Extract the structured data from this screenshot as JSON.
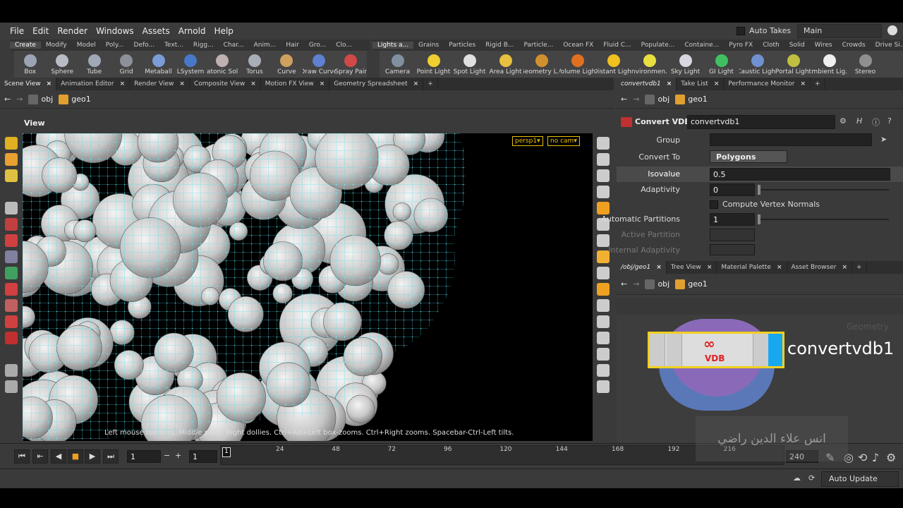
{
  "menubar": {
    "items": [
      "File",
      "Edit",
      "Render",
      "Windows",
      "Assets",
      "Arnold",
      "Help"
    ],
    "auto_takes": "Auto Takes",
    "main_select": "Main"
  },
  "shelf_left": {
    "tabs": [
      "Create",
      "Modify",
      "Model",
      "Poly...",
      "Defo...",
      "Text...",
      "Rigg...",
      "Char...",
      "Anim...",
      "Hair",
      "Gro...",
      "Clo..."
    ],
    "tools": [
      {
        "label": "Box",
        "color": "#9aa4b4"
      },
      {
        "label": "Sphere",
        "color": "#b8bcc4"
      },
      {
        "label": "Tube",
        "color": "#a0a8b8"
      },
      {
        "label": "Grid",
        "color": "#8c9098"
      },
      {
        "label": "Metaball",
        "color": "#7b9cd6"
      },
      {
        "label": "LSystem",
        "color": "#4a78c8"
      },
      {
        "label": "Platonic Sol...",
        "color": "#c0b0b0"
      },
      {
        "label": "Torus",
        "color": "#a8aeb8"
      },
      {
        "label": "Curve",
        "color": "#d0a060"
      },
      {
        "label": "Draw Curve",
        "color": "#6080d0"
      },
      {
        "label": "Spray Pair",
        "color": "#d04848"
      }
    ]
  },
  "shelf_right": {
    "tabs": [
      "Lights a...",
      "Grains",
      "Particles",
      "Rigid B...",
      "Particle...",
      "Ocean FX",
      "Fluid C...",
      "Populate...",
      "Containe...",
      "Pyro FX",
      "Cloth",
      "Solid",
      "Wires",
      "Crowds",
      "Drive Si..."
    ],
    "tools": [
      {
        "label": "Camera",
        "color": "#8090a0"
      },
      {
        "label": "Point Light",
        "color": "#f0d030"
      },
      {
        "label": "Spot Light",
        "color": "#e0e0e0"
      },
      {
        "label": "Area Light",
        "color": "#e8c040"
      },
      {
        "label": "Geometry L...",
        "color": "#d09030"
      },
      {
        "label": "Volume Light",
        "color": "#e07020"
      },
      {
        "label": "Distant Light",
        "color": "#f0c020"
      },
      {
        "label": "Environmen...",
        "color": "#e8e040"
      },
      {
        "label": "Sky Light",
        "color": "#d8d8e0"
      },
      {
        "label": "GI Light",
        "color": "#40c060"
      },
      {
        "label": "Caustic Light",
        "color": "#7090d0"
      },
      {
        "label": "Portal Light",
        "color": "#c0c040"
      },
      {
        "label": "Ambient Lig...",
        "color": "#f0f0f0"
      },
      {
        "label": "Stereo",
        "color": "#909090"
      }
    ]
  },
  "left_pane": {
    "tabs": [
      "Scene View",
      "Animation Editor",
      "Render View",
      "Composite View",
      "Motion FX View",
      "Geometry Spreadsheet"
    ],
    "path": [
      "obj",
      "geo1"
    ],
    "view_title": "View",
    "persp": "persp1",
    "cam": "no cam",
    "hint": "Left mouse tumbles. Middle pans. Right dollies. Ctrl+Alt+Left box-zooms. Ctrl+Right zooms. Spacebar-Ctrl-Left tilts."
  },
  "param_pane": {
    "tabs": [
      "convertvdb1",
      "Take List",
      "Performance Monitor"
    ],
    "path": [
      "obj",
      "geo1"
    ],
    "node_type": "Convert VDB",
    "node_name": "convertvdb1",
    "params": {
      "group_label": "Group",
      "group_value": "",
      "convert_to_label": "Convert To",
      "convert_to_value": "Polygons",
      "isovalue_label": "Isovalue",
      "isovalue_value": "0.5",
      "adaptivity_label": "Adaptivity",
      "adaptivity_value": "0",
      "compute_normals_label": "Compute Vertex Normals",
      "auto_partitions_label": "Automatic Partitions",
      "auto_partitions_value": "1",
      "active_partition_label": "Active Partition",
      "internal_adaptivity_label": "Internal Adaptivity"
    }
  },
  "network_pane": {
    "tabs": [
      "/obj/geo1",
      "Tree View",
      "Material Palette",
      "Asset Browser"
    ],
    "path": [
      "obj",
      "geo1"
    ],
    "context_label": "Geometry",
    "node_label": "convertvdb1",
    "node_icon_text": "VDB"
  },
  "timeline": {
    "current_frame": "1",
    "start_frame": "1",
    "end_frame": "240",
    "frame_marker": "1",
    "ticks": [
      "24",
      "48",
      "72",
      "96",
      "120",
      "144",
      "168",
      "192",
      "216"
    ]
  },
  "status": {
    "auto_update": "Auto Update"
  },
  "watermark": "انس علاء الدين راضي",
  "colors": {
    "wire": "#3fd8e8",
    "accent": "#f0a020",
    "node_outline": "#f0d020",
    "vdb_red": "#e02020"
  }
}
